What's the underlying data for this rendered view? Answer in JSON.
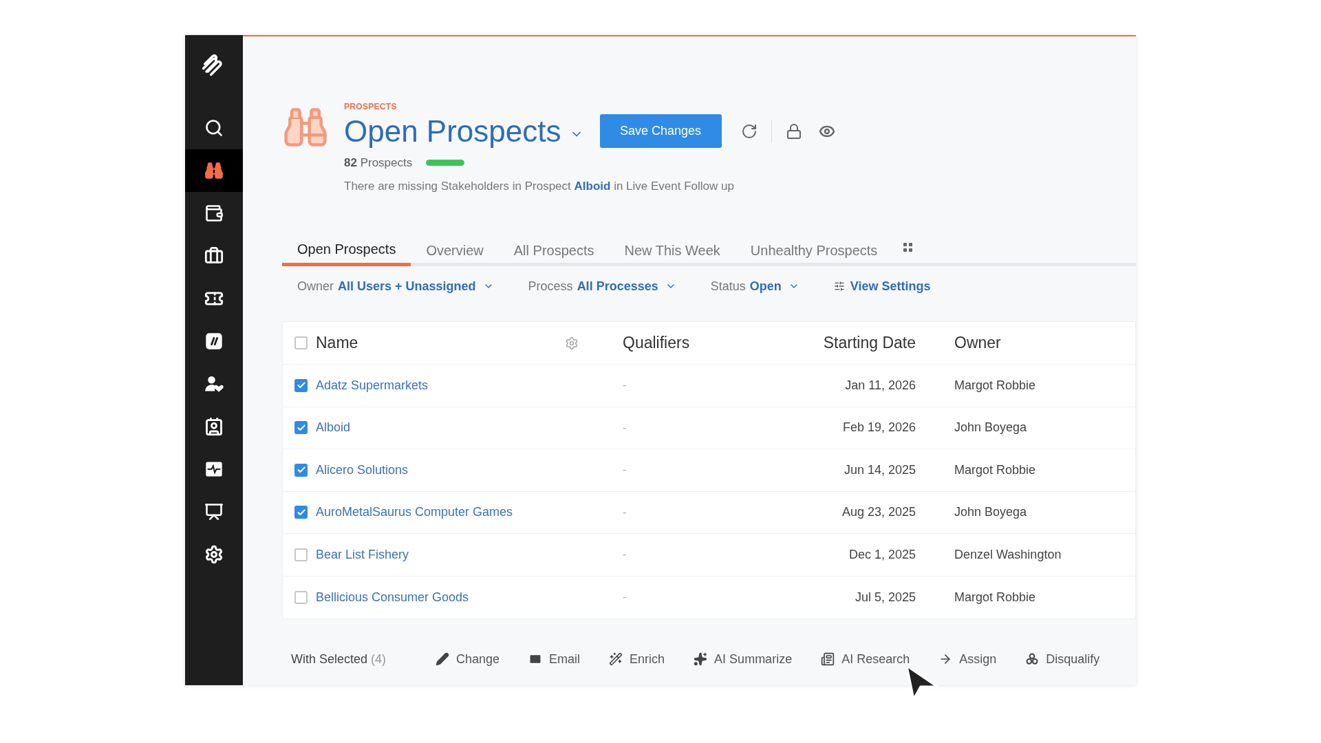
{
  "sidebar": {
    "items": [
      {
        "kind": "search",
        "selected": false
      },
      {
        "kind": "binoculars",
        "selected": true
      },
      {
        "kind": "wallet",
        "selected": false
      },
      {
        "kind": "briefcase",
        "selected": false
      },
      {
        "kind": "ticket",
        "selected": false
      },
      {
        "kind": "slashes",
        "selected": false
      },
      {
        "kind": "user-heart",
        "selected": false
      },
      {
        "kind": "contacts",
        "selected": false
      },
      {
        "kind": "pulse",
        "selected": false
      },
      {
        "kind": "presentation",
        "selected": false
      },
      {
        "kind": "settings",
        "selected": false
      }
    ]
  },
  "header": {
    "eyebrow": "PROSPECTS",
    "title": "Open Prospects",
    "save_button": "Save Changes",
    "count": "82",
    "count_label": "Prospects",
    "health_bar": {
      "level": 1
    },
    "message": {
      "before": "There are missing Stakeholders in Prospect",
      "link": "Alboid",
      "after": "in Live Event Follow up"
    }
  },
  "tabs": [
    {
      "label": "Open Prospects",
      "selected": true
    },
    {
      "label": "Overview",
      "selected": false
    },
    {
      "label": "All Prospects",
      "selected": false
    },
    {
      "label": "New This Week",
      "selected": false
    },
    {
      "label": "Unhealthy Prospects",
      "selected": false
    }
  ],
  "filters": [
    {
      "label": "Owner",
      "value": "All Users + Unassigned"
    },
    {
      "label": "Process",
      "value": "All Processes"
    },
    {
      "label": "Status",
      "value": "Open"
    }
  ],
  "view_settings": "View Settings",
  "table": {
    "columns": [
      "Name",
      "Qualifiers",
      "Starting Date",
      "Owner"
    ],
    "select_all_checked": false,
    "rows": [
      {
        "name": "Adatz Supermarkets",
        "qualifiers": "-",
        "starting_date": "Jan 11, 2026",
        "owner": "Margot Robbie",
        "checked": true
      },
      {
        "name": "Alboid",
        "qualifiers": "-",
        "starting_date": "Feb 19, 2026",
        "owner": "John Boyega",
        "checked": true
      },
      {
        "name": "Alicero Solutions",
        "qualifiers": "-",
        "starting_date": "Jun 14, 2025",
        "owner": "Margot Robbie",
        "checked": true
      },
      {
        "name": "AuroMetalSaurus Computer Games",
        "qualifiers": "-",
        "starting_date": "Aug 23, 2025",
        "owner": "John Boyega",
        "checked": true
      },
      {
        "name": "Bear List Fishery",
        "qualifiers": "-",
        "starting_date": "Dec 1, 2025",
        "owner": "Denzel Washington",
        "checked": false
      },
      {
        "name": "Bellicious Consumer Goods",
        "qualifiers": "-",
        "starting_date": "Jul 5, 2025",
        "owner": "Margot Robbie",
        "checked": false
      }
    ]
  },
  "bulk_bar": {
    "label": "With Selected",
    "count": "(4)",
    "actions": [
      {
        "kind": "change",
        "label": "Change"
      },
      {
        "kind": "email",
        "label": "Email"
      },
      {
        "kind": "enrich",
        "label": "Enrich"
      },
      {
        "kind": "summarize",
        "label": "AI Summarize"
      },
      {
        "kind": "research",
        "label": "AI Research"
      },
      {
        "kind": "assign",
        "label": "Assign"
      },
      {
        "kind": "disqualify",
        "label": "Disqualify"
      }
    ]
  }
}
